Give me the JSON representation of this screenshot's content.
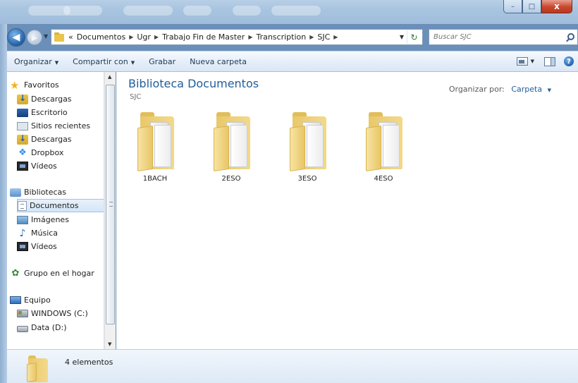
{
  "window": {
    "minimize_glyph": "–",
    "maximize_glyph": "□",
    "close_glyph": "x"
  },
  "address": {
    "crumbs": [
      "Documentos",
      "Ugr",
      "Trabajo Fin de Master",
      "Transcription",
      "SJC"
    ],
    "overflow": "«",
    "search_placeholder": "Buscar SJC"
  },
  "toolbar": {
    "organize_label": "Organizar",
    "share_label": "Compartir con",
    "burn_label": "Grabar",
    "new_folder_label": "Nueva carpeta"
  },
  "nav": {
    "favorites": {
      "label": "Favoritos",
      "items": [
        {
          "label": "Descargas",
          "icon": "download-folder-icon"
        },
        {
          "label": "Escritorio",
          "icon": "desktop-icon"
        },
        {
          "label": "Sitios recientes",
          "icon": "recent-places-icon"
        },
        {
          "label": "Descargas",
          "icon": "download-folder-icon"
        },
        {
          "label": "Dropbox",
          "icon": "dropbox-icon"
        },
        {
          "label": "Vídeos",
          "icon": "video-icon"
        }
      ]
    },
    "libraries": {
      "label": "Bibliotecas",
      "items": [
        {
          "label": "Documentos",
          "icon": "documents-icon",
          "selected": true
        },
        {
          "label": "Imágenes",
          "icon": "pictures-icon"
        },
        {
          "label": "Música",
          "icon": "music-icon"
        },
        {
          "label": "Vídeos",
          "icon": "video-icon"
        }
      ]
    },
    "homegroup": {
      "label": "Grupo en el hogar"
    },
    "computer": {
      "label": "Equipo",
      "items": [
        {
          "label": "WINDOWS (C:)",
          "icon": "windows-drive-icon"
        },
        {
          "label": "Data (D:)",
          "icon": "drive-icon"
        }
      ]
    }
  },
  "content": {
    "title": "Biblioteca Documentos",
    "subtitle": "SJC",
    "arrange_label": "Organizar por:",
    "arrange_value": "Carpeta",
    "folders": [
      "1BACH",
      "2ESO",
      "3ESO",
      "4ESO"
    ]
  },
  "details": {
    "count": "4 elementos"
  }
}
